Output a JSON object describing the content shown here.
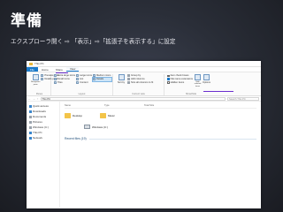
{
  "slide": {
    "title": "準備",
    "subtitle": "エクスプローラ開く ⇨ 「表示」⇨「拡張子を表示する」に設定"
  },
  "explorer": {
    "window_title": "This PC",
    "tabs": [
      "File",
      "Home",
      "Share",
      "View"
    ],
    "ribbon": {
      "panes": {
        "nav_pane": "Navigation pane",
        "preview": "Preview pane",
        "details": "Details pane",
        "group": "Panes"
      },
      "layout": {
        "items": [
          "Extra large icons",
          "Large icons",
          "Medium icons",
          "Small icons",
          "List",
          "Details",
          "Tiles",
          "Content"
        ],
        "group": "Layout"
      },
      "current_view": {
        "sort_by": "Sort by",
        "group_by": "Group by",
        "add_columns": "Add columns",
        "size_all": "Size all columns to fit",
        "group": "Current view"
      },
      "show_hide": {
        "item_checkboxes": "Item check boxes",
        "file_name_extensions": "File name extensions",
        "hidden_items": "Hidden items",
        "hide_selected": "Hide selected items",
        "options": "Options",
        "group": "Show/hide"
      }
    },
    "address": {
      "path": "This PC",
      "search_placeholder": "Search This PC"
    },
    "nav_items": [
      "Quick access",
      "Downloads",
      "Documents",
      "Pictures",
      "Windows (C:)",
      "This PC",
      "Network"
    ],
    "columns": [
      "Name",
      "Type",
      "Total Size"
    ],
    "folders": [
      {
        "name": "Desktop",
        "meta": ""
      },
      {
        "name": "Music",
        "meta": ""
      }
    ],
    "drives": [
      {
        "name": "Windows (C:)",
        "meta": ""
      }
    ],
    "section_label": "Recent files (19)"
  },
  "colors": {
    "accent": "#1979ca",
    "annotation": "#6a2ecf",
    "folder": "#f3c449"
  }
}
